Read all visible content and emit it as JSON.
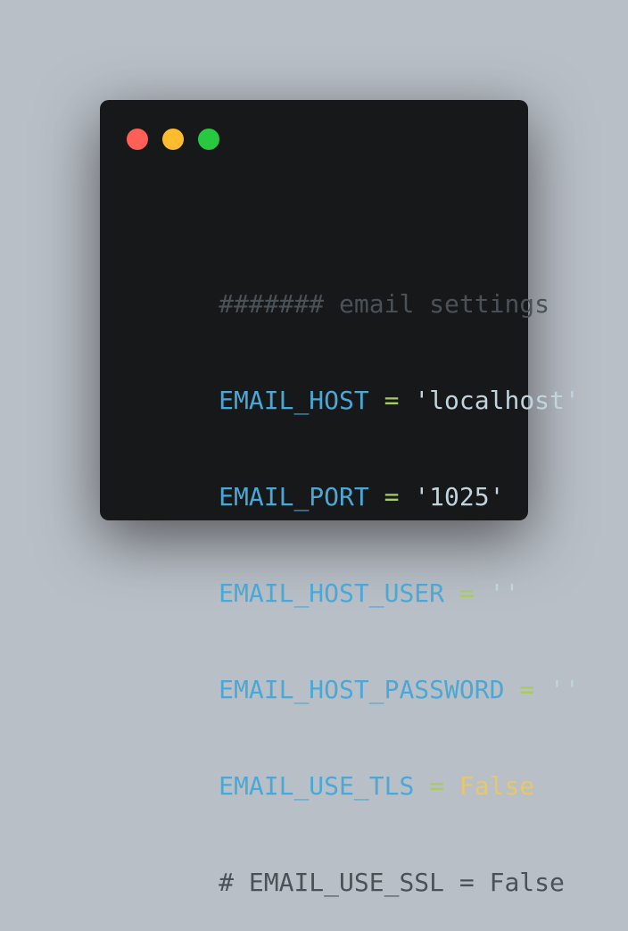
{
  "window": {
    "controls": {
      "close_color": "#ff5f57",
      "minimize_color": "#febc2e",
      "zoom_color": "#28c840"
    }
  },
  "colors": {
    "comment": "#4a5257",
    "identifier": "#4aa8d6",
    "operator": "#a8cc5c",
    "string": "#c2d3dc",
    "constant": "#e8c66a"
  },
  "code": {
    "line1": {
      "comment": "####### email settings"
    },
    "line2": {
      "name": "EMAIL_HOST",
      "op": " = ",
      "value": "'localhost'"
    },
    "line3": {
      "name": "EMAIL_PORT",
      "op": " = ",
      "value": "'1025'"
    },
    "line4": {
      "name": "EMAIL_HOST_USER",
      "op": " = ",
      "value": "''"
    },
    "line5": {
      "name": "EMAIL_HOST_PASSWORD",
      "op": " = ",
      "value": "''"
    },
    "line6": {
      "name": "EMAIL_USE_TLS",
      "op": " = ",
      "value": "False"
    },
    "line7": {
      "comment": "# EMAIL_USE_SSL = False"
    }
  }
}
